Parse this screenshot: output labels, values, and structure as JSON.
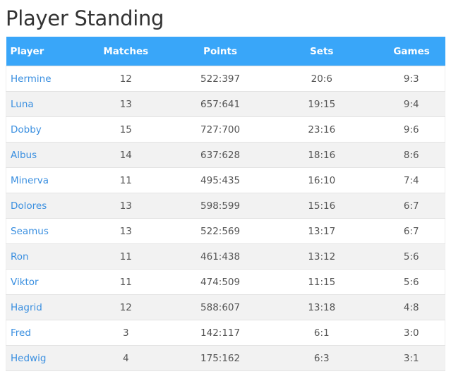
{
  "page": {
    "title": "Player Standing"
  },
  "colors": {
    "header_bg": "#39a6f9",
    "header_text": "#ffffff",
    "link": "#3a8fe0",
    "row_alt": "#f2f2f2"
  },
  "table": {
    "columns": [
      "Player",
      "Matches",
      "Points",
      "Sets",
      "Games"
    ],
    "rows": [
      {
        "player": "Hermine",
        "matches": "12",
        "points": "522:397",
        "sets": "20:6",
        "games": "9:3"
      },
      {
        "player": "Luna",
        "matches": "13",
        "points": "657:641",
        "sets": "19:15",
        "games": "9:4"
      },
      {
        "player": "Dobby",
        "matches": "15",
        "points": "727:700",
        "sets": "23:16",
        "games": "9:6"
      },
      {
        "player": "Albus",
        "matches": "14",
        "points": "637:628",
        "sets": "18:16",
        "games": "8:6"
      },
      {
        "player": "Minerva",
        "matches": "11",
        "points": "495:435",
        "sets": "16:10",
        "games": "7:4"
      },
      {
        "player": "Dolores",
        "matches": "13",
        "points": "598:599",
        "sets": "15:16",
        "games": "6:7"
      },
      {
        "player": "Seamus",
        "matches": "13",
        "points": "522:569",
        "sets": "13:17",
        "games": "6:7"
      },
      {
        "player": "Ron",
        "matches": "11",
        "points": "461:438",
        "sets": "13:12",
        "games": "5:6"
      },
      {
        "player": "Viktor",
        "matches": "11",
        "points": "474:509",
        "sets": "11:15",
        "games": "5:6"
      },
      {
        "player": "Hagrid",
        "matches": "12",
        "points": "588:607",
        "sets": "13:18",
        "games": "4:8"
      },
      {
        "player": "Fred",
        "matches": "3",
        "points": "142:117",
        "sets": "6:1",
        "games": "3:0"
      },
      {
        "player": "Hedwig",
        "matches": "4",
        "points": "175:162",
        "sets": "6:3",
        "games": "3:1"
      }
    ]
  }
}
